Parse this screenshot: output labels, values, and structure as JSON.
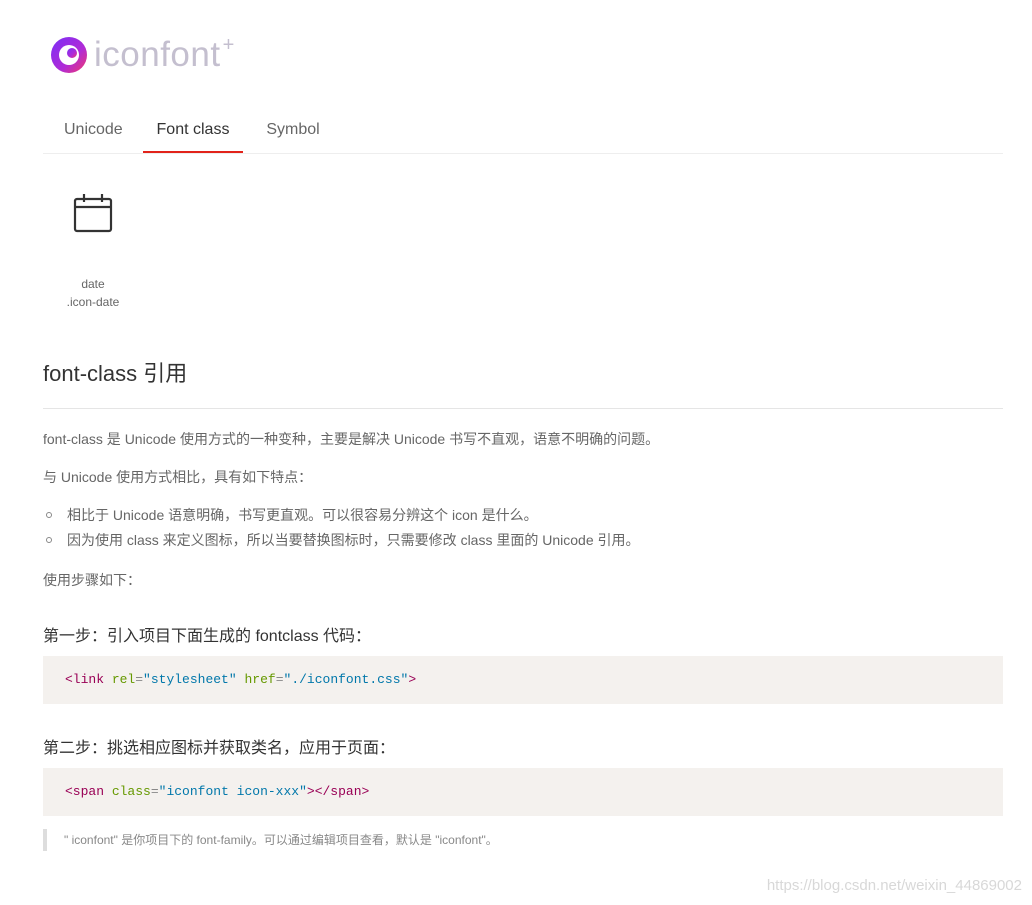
{
  "brand": {
    "name": "iconfont",
    "plus": "+"
  },
  "tabs": [
    {
      "label": "Unicode"
    },
    {
      "label": "Font class"
    },
    {
      "label": "Symbol"
    }
  ],
  "icons": [
    {
      "name": "date",
      "code": ".icon-date",
      "glyph": "calendar-icon"
    }
  ],
  "section": {
    "title": "font-class 引用",
    "intro": "font-class 是 Unicode 使用方式的一种变种，主要是解决 Unicode 书写不直观，语意不明确的问题。",
    "compare": "与 Unicode 使用方式相比，具有如下特点：",
    "features": [
      "相比于 Unicode 语意明确，书写更直观。可以很容易分辨这个 icon 是什么。",
      "因为使用 class 来定义图标，所以当要替换图标时，只需要修改 class 里面的 Unicode 引用。"
    ],
    "usage": "使用步骤如下："
  },
  "steps": [
    {
      "title": "第一步：引入项目下面生成的 fontclass 代码：",
      "code": {
        "open": "<link",
        "attr1": "rel",
        "val1": "\"stylesheet\"",
        "attr2": "href",
        "val2": "\"./iconfont.css\"",
        "close": ">"
      }
    },
    {
      "title": "第二步：挑选相应图标并获取类名，应用于页面：",
      "code": {
        "open": "<span",
        "attr1": "class",
        "val1": "\"iconfont icon-xxx\"",
        "close": "></span>"
      }
    }
  ],
  "note": "\" iconfont\" 是你项目下的 font-family。可以通过编辑项目查看，默认是 \"iconfont\"。",
  "watermark": "https://blog.csdn.net/weixin_44869002",
  "colors": {
    "accent": "#e2231a",
    "code_bg": "#f4f1ee",
    "tag": "#990055",
    "attr": "#669900",
    "string": "#0077aa"
  }
}
